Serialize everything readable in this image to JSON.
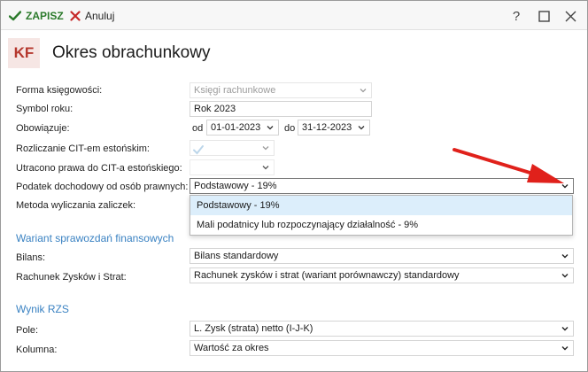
{
  "toolbar": {
    "save_label": "ZAPISZ",
    "cancel_label": "Anuluj",
    "help_label": "?",
    "accent_save": "#2b7a2b",
    "accent_cancel": "#c62828"
  },
  "header": {
    "logo_text": "KF",
    "title": "Okres obrachunkowy"
  },
  "form": {
    "forma": {
      "label": "Forma księgowości:",
      "value": "Księgi rachunkowe"
    },
    "symbol": {
      "label": "Symbol roku:",
      "value": "Rok 2023"
    },
    "obowiazuje": {
      "label": "Obowiązuje:",
      "od_label": "od",
      "od_value": "01-01-2023",
      "do_label": "do",
      "do_value": "31-12-2023"
    },
    "cit_estonski": {
      "label": "Rozliczanie CIT-em estońskim:",
      "checked": true
    },
    "utracono": {
      "label": "Utracono prawa do CIT-a estońskiego:",
      "value": ""
    },
    "podatek": {
      "label": "Podatek dochodowy od osób prawnych:",
      "value": "Podstawowy - 19%"
    },
    "metoda": {
      "label": "Metoda wyliczania zaliczek:"
    }
  },
  "dropdown": {
    "options": [
      "Podstawowy - 19%",
      "Mali podatnicy lub rozpoczynający działalność - 9%"
    ],
    "selected_index": 0
  },
  "wariant": {
    "section_title": "Wariant sprawozdań finansowych",
    "bilans": {
      "label": "Bilans:",
      "value": "Bilans standardowy"
    },
    "rzis": {
      "label": "Rachunek Zysków i Strat:",
      "value": "Rachunek zysków i strat (wariant porównawczy) standardowy"
    }
  },
  "wynik": {
    "section_title": "Wynik RZS",
    "pole": {
      "label": "Pole:",
      "value": "L. Zysk (strata) netto (I-J-K)"
    },
    "kolumna": {
      "label": "Kolumna:",
      "value": "Wartość za okres"
    }
  },
  "colors": {
    "section": "#3a82c2",
    "logo_bg": "#f6e6e4",
    "logo_fg": "#b5382e",
    "dropdown_selected": "#dceefb",
    "arrow": "#e0211b"
  }
}
